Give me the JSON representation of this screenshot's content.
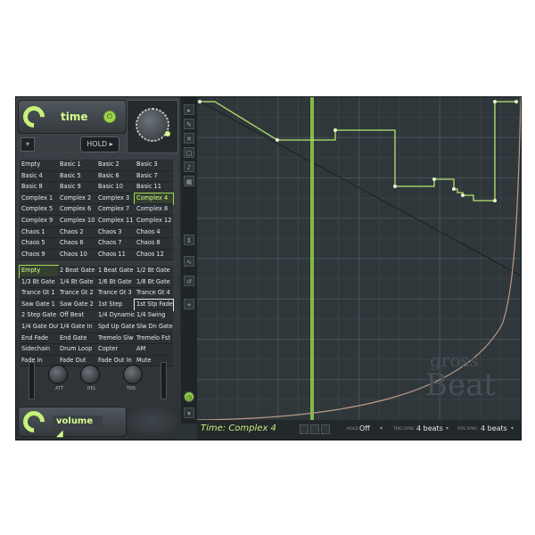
{
  "app": {
    "title": "gross Beat"
  },
  "time_panel": {
    "label": "time",
    "power_icon": "power-icon",
    "hold_label": "HOLD"
  },
  "time_presets": [
    "Empty",
    "Basic 1",
    "Basic 2",
    "Basic 3",
    "Basic 4",
    "Basic 5",
    "Basic 6",
    "Basic 7",
    "Basic 8",
    "Basic 9",
    "Basic 10",
    "Basic 11",
    "Complex 1",
    "Complex 2",
    "Complex 3",
    "Complex 4",
    "Complex 5",
    "Complex 6",
    "Complex 7",
    "Complex 8",
    "Complex 9",
    "Complex 10",
    "Complex 11",
    "Complex 12",
    "Chaos 1",
    "Chaos 2",
    "Chaos 3",
    "Chaos 4",
    "Chaos 5",
    "Chaos 6",
    "Chaos 7",
    "Chaos 8",
    "Chaos 9",
    "Chaos 10",
    "Chaos 11",
    "Chaos 12"
  ],
  "time_selected": "Complex 4",
  "volume_presets": [
    "Empty",
    "2 Beat Gate",
    "1 Beat Gate",
    "1/2 Bt Gate",
    "1/3 Bt Gate",
    "1/4 Bt Gate",
    "1/6 Bt Gate",
    "1/8 Bt Gate",
    "Trance Gt 1",
    "Trance Gt 2",
    "Trance Gt 3",
    "Trance Gt 4",
    "Saw Gate 1",
    "Saw Gate 2",
    "1st Step",
    "1st Stp Fade",
    "2 Step Gate",
    "Off Beat",
    "1/4 Dynamic",
    "1/4 Swing",
    "1/4 Gate Out",
    "1/4 Gate In",
    "Spd Up Gate",
    "Slw Dn Gate",
    "End Fade",
    "End Gate",
    "Tremelo Slw",
    "Tremelo Fst",
    "Sidechain",
    "Drum Loop",
    "Copter",
    "AM",
    "Fade In",
    "Fade Out",
    "Fade Out In",
    "Mute"
  ],
  "volume_selected": "Empty",
  "volume_highlighted": "1st Stp Fade",
  "envelope": {
    "att_label": "ATT",
    "rel_label": "REL",
    "tns_label": "TNS"
  },
  "volume_panel": {
    "label": "volume"
  },
  "footer": {
    "title": "Time: Complex 4",
    "hold_label": "HOLD",
    "hold_value": "Off",
    "trig_sync_label": "TRIG SYNC",
    "trig_sync_value": "4 beats",
    "pos_sync_label": "POS SYNC",
    "pos_sync_value": "4 beats"
  },
  "watermark": {
    "line1": "gross",
    "line2": "Beat"
  },
  "colors": {
    "accent": "#c7f27a",
    "background": "#2d3438",
    "curve": "#b99a86"
  }
}
